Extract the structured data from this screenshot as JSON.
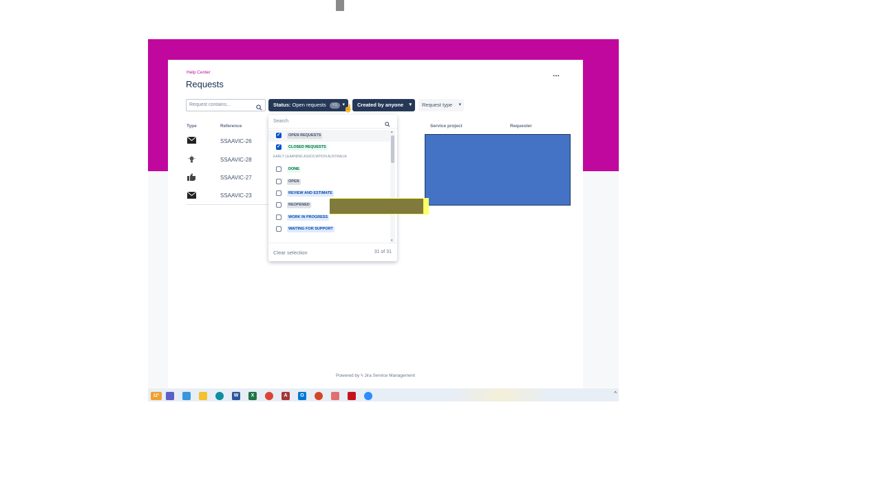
{
  "header": {
    "breadcrumb": "Help Center",
    "title": "Requests",
    "more_label": "..."
  },
  "filters": {
    "search_placeholder": "Request contains...",
    "status_label": "Status:",
    "status_value": "Open requests",
    "status_badge": "+1",
    "created_label": "Created by anyone",
    "request_type_label": "Request type"
  },
  "table": {
    "columns": {
      "type": "Type",
      "reference": "Reference",
      "service_project": "Service project",
      "requester": "Requester"
    },
    "rows": [
      {
        "icon": "envelope-icon",
        "reference": "SSAAVIC-26"
      },
      {
        "icon": "lightbulb-icon",
        "reference": "SSAAVIC-28"
      },
      {
        "icon": "thumbs-up-icon",
        "reference": "SSAAVIC-27"
      },
      {
        "icon": "envelope-icon",
        "reference": "SSAAVIC-23"
      }
    ]
  },
  "dropdown": {
    "search_placeholder": "Search",
    "items": [
      {
        "label": "OPEN REQUESTS",
        "checked": true,
        "style": "grey"
      },
      {
        "label": "CLOSED REQUESTS",
        "checked": true,
        "style": "green"
      }
    ],
    "group_label": "EARLY LEARNING ASSOCIATION AUSTRALIA",
    "group_items": [
      {
        "label": "DONE",
        "checked": false,
        "style": "green"
      },
      {
        "label": "OPEN",
        "checked": false,
        "style": "grey"
      },
      {
        "label": "REVIEW AND ESTIMATE",
        "checked": false,
        "style": "blue"
      },
      {
        "label": "REOPENED",
        "checked": false,
        "style": "grey"
      },
      {
        "label": "WORK IN PROGRESS",
        "checked": false,
        "style": "blue"
      },
      {
        "label": "WAITING FOR SUPPORT",
        "checked": false,
        "style": "blue"
      }
    ],
    "clear_label": "Clear selection",
    "count_label": "31 of 31"
  },
  "footer": {
    "powered_by": "Powered by",
    "product": "Jira Service Management"
  },
  "taskbar": {
    "weather": "12°",
    "apps": [
      "weather-icon",
      "teams-icon",
      "photos-icon",
      "file-explorer-icon",
      "edge-icon",
      "word-icon",
      "excel-icon",
      "chrome-icon",
      "access-icon",
      "outlook-icon",
      "powerpoint-icon",
      "snipping-tool-icon",
      "acrobat-icon",
      "zoom-icon"
    ]
  },
  "colors": {
    "brand_banner": "#c0089e",
    "button_dark": "#253858",
    "redaction_blue": "#4472c4",
    "redaction_olive": "#807a3c",
    "highlight_yellow": "#ffff66"
  }
}
